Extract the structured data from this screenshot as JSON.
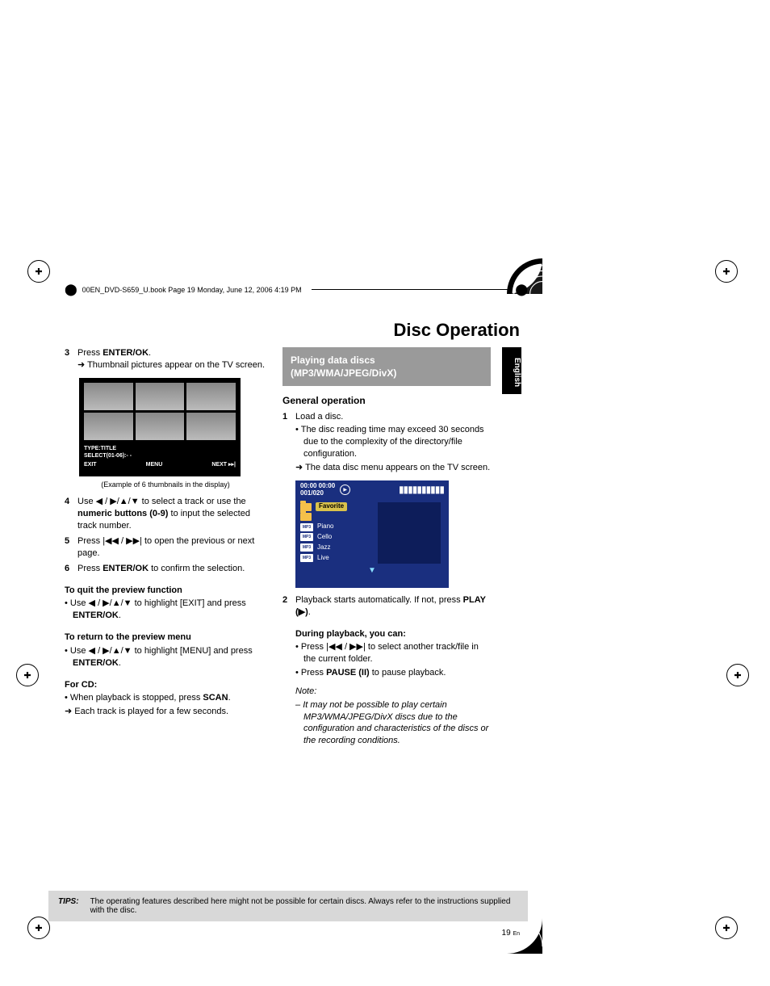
{
  "header_ghost": "00EN_DVD-S659_U.book  Page 19  Monday, June 12, 2006  4:19 PM",
  "doc_title": "Disc Operation",
  "language_tab": "English",
  "left": {
    "step3_num": "3",
    "step3_text_a": "Press ",
    "step3_text_b": "ENTER/OK",
    "step3_text_c": ".",
    "step3_arrow": "Thumbnail pictures appear on the TV screen.",
    "thumb_label1": "TYPE:TITLE",
    "thumb_label2": "SELECT(01-06):- -",
    "thumb_menu_exit": "EXIT",
    "thumb_menu_menu": "MENU",
    "thumb_menu_next": "NEXT ▸▸|",
    "thumb_caption": "(Example of 6 thumbnails in the display)",
    "step4_num": "4",
    "step4_a": "Use ",
    "step4_arrows": "◀ / ▶/▲/▼",
    "step4_b": " to select a track or use the ",
    "step4_c": "numeric buttons (0-9)",
    "step4_d": " to input the selected track number.",
    "step5_num": "5",
    "step5_a": "Press ",
    "step5_icons": "|◀◀ / ▶▶|",
    "step5_b": " to open the previous or next page.",
    "step6_num": "6",
    "step6_a": "Press ",
    "step6_b": "ENTER/OK",
    "step6_c": " to confirm the selection.",
    "quit_hd": "To quit the preview function",
    "quit_a": "Use ",
    "quit_arrows": "◀ / ▶/▲/▼",
    "quit_b": " to highlight [EXIT] and press ",
    "quit_c": "ENTER/OK",
    "quit_d": ".",
    "return_hd": "To return to the preview menu",
    "return_a": "Use ",
    "return_arrows": "◀ / ▶/▲/▼",
    "return_b": " to highlight [MENU] and press ",
    "return_c": "ENTER/OK",
    "return_d": ".",
    "cd_hd": "For CD:",
    "cd_bullet_a": "When playback is stopped, press ",
    "cd_bullet_b": "SCAN",
    "cd_bullet_c": ".",
    "cd_arrow": "Each track is played for a few seconds."
  },
  "right": {
    "grey_title": "Playing data discs (MP3/WMA/JPEG/DivX)",
    "general_hd": "General operation",
    "step1_num": "1",
    "step1_text": "Load a disc.",
    "step1_bullet": "The disc reading time may exceed 30 seconds due to the complexity of the directory/file configuration.",
    "step1_arrow": "The data disc menu appears on the TV screen.",
    "disc_time": "00:00   00:00",
    "disc_count": "001/020",
    "folder_favorite": "Favorite",
    "track_piano": "Piano",
    "track_cello": "Cello",
    "track_jazz": "Jazz",
    "track_live": "Live",
    "mp3_label": "MP3",
    "step2_num": "2",
    "step2_a": "Playback starts automatically. If not, press ",
    "step2_b": "PLAY (▶)",
    "step2_c": ".",
    "during_hd": "During playback, you can:",
    "during_b1_a": "Press ",
    "during_b1_icons": "|◀◀ / ▶▶|",
    "during_b1_b": " to select another track/file in the current folder.",
    "during_b2_a": "Press ",
    "during_b2_b": "PAUSE (II)",
    "during_b2_c": " to pause playback.",
    "note_label": "Note:",
    "note_text": "It may not be possible to play certain MP3/WMA/JPEG/DivX discs due to the configuration and characteristics of the discs or the recording conditions."
  },
  "tips_label": "TIPS:",
  "tips_text": "The operating features described here might not be possible for certain discs. Always refer to the instructions supplied with the disc.",
  "page_number": "19",
  "page_number_suffix": "En"
}
